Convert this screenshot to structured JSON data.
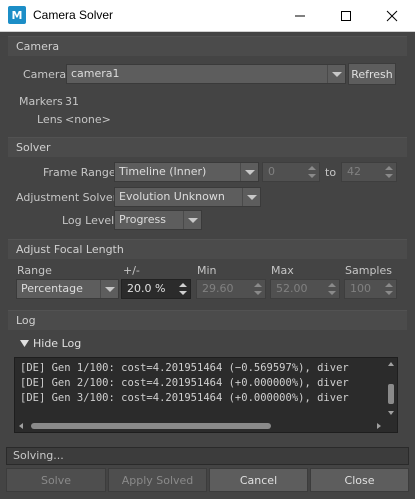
{
  "window": {
    "title": "Camera Solver",
    "icon_letter": "M"
  },
  "camera_section": {
    "header": "Camera",
    "camera_label": "Camera",
    "camera_value": "camera1",
    "refresh_label": "Refresh",
    "markers_label": "Markers",
    "markers_value": "31",
    "lens_label": "Lens",
    "lens_value": "<none>"
  },
  "solver_section": {
    "header": "Solver",
    "frame_range_label": "Frame Range",
    "frame_range_value": "Timeline (Inner)",
    "frame_start": "0",
    "to_label": "to",
    "frame_end": "42",
    "adjustment_solver_label": "Adjustment Solver",
    "adjustment_solver_value": "Evolution Unknown",
    "log_level_label": "Log Level",
    "log_level_value": "Progress"
  },
  "focal_section": {
    "header": "Adjust Focal Length",
    "col_range": "Range",
    "col_plusminus": "+/-",
    "col_min": "Min",
    "col_max": "Max",
    "col_samples": "Samples",
    "range_value": "Percentage",
    "plusminus_value": "20.0 %",
    "min_value": "29.60",
    "max_value": "52.00",
    "samples_value": "100"
  },
  "log_section": {
    "header": "Log",
    "toggle_label": "Hide Log",
    "lines": [
      "[DE] Gen 1/100: cost=4.201951464 (−0.569597%), diver",
      "[DE] Gen 2/100: cost=4.201951464 (+0.000000%), diver",
      "[DE] Gen 3/100: cost=4.201951464 (+0.000000%), diver"
    ]
  },
  "status_text": "Solving...",
  "buttons": {
    "solve": "Solve",
    "apply_solved": "Apply Solved",
    "cancel": "Cancel",
    "close": "Close"
  },
  "colors": {
    "window_bg": "#444444",
    "titlebar_bg": "#ffffff",
    "app_icon": "#1c8ec7",
    "field_dark": "#2b2b2b"
  }
}
